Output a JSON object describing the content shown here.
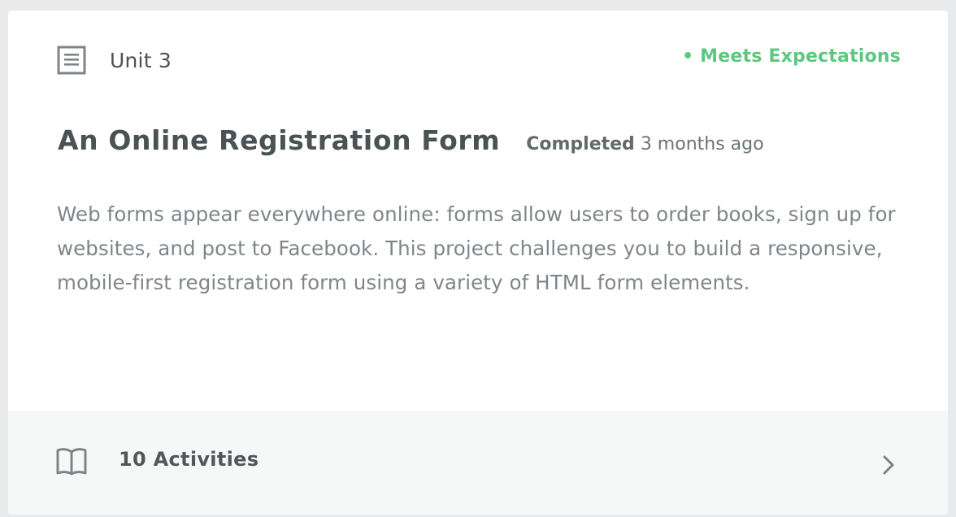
{
  "unit": {
    "label": "Unit 3",
    "icon": "document-icon"
  },
  "status": {
    "text": "• Meets Expectations",
    "color": "#5cc87f"
  },
  "project": {
    "title": "An Online Registration Form",
    "completed_label": "Completed",
    "completed_time": "3 months ago",
    "description": "Web forms appear everywhere online: forms allow users to order books, sign up for websites, and post to Facebook. This project challenges you to build a responsive, mobile-first registration form using a variety of HTML form elements."
  },
  "footer": {
    "activities_label": "10 Activities",
    "icon": "book-icon",
    "action_icon": "chevron-right-icon"
  }
}
